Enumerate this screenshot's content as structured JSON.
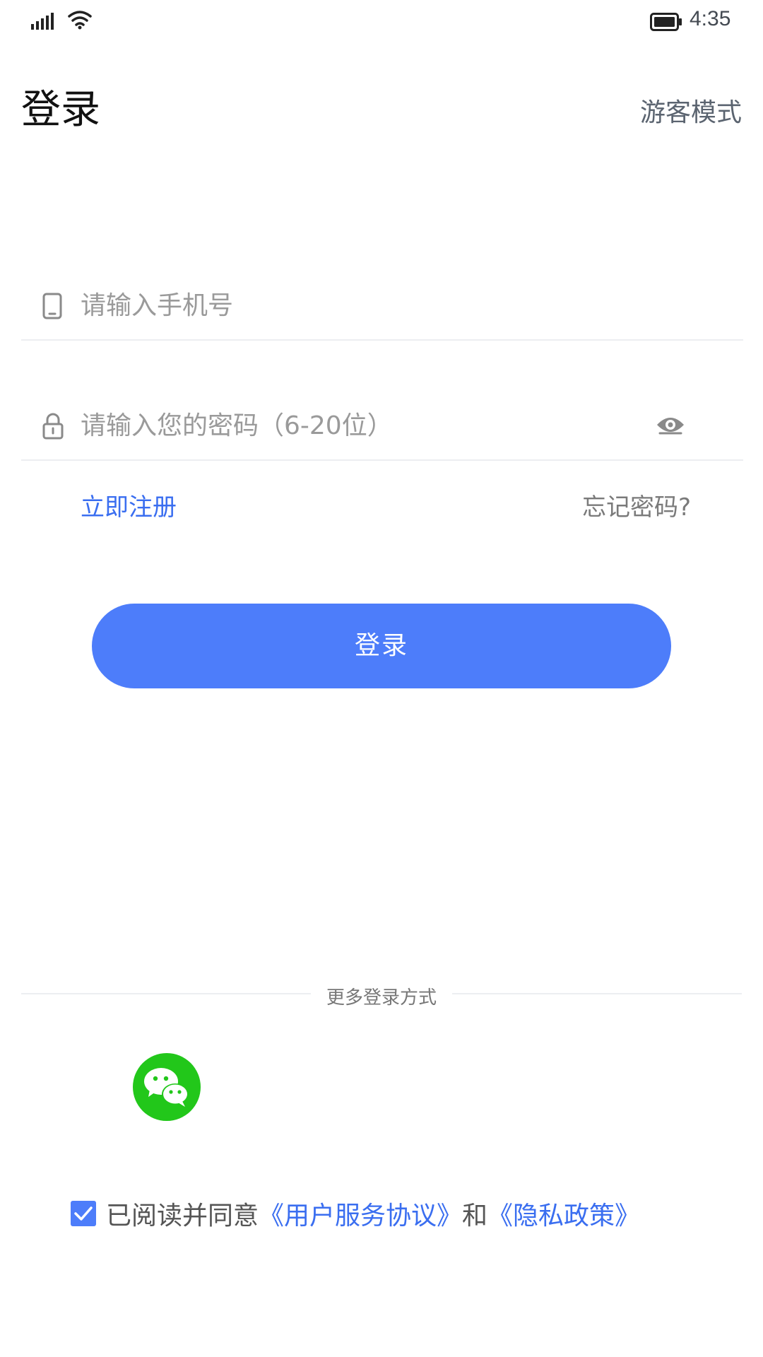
{
  "status_bar": {
    "time": "4:35",
    "signal_icon": "signal-icon",
    "wifi_icon": "wifi-icon",
    "battery_icon": "battery-icon"
  },
  "header": {
    "title": "登录",
    "guest_mode": "游客模式"
  },
  "form": {
    "phone_placeholder": "请输入手机号",
    "password_placeholder": "请输入您的密码（6-20位）",
    "register_link": "立即注册",
    "forgot_link": "忘记密码?",
    "login_button": "登录"
  },
  "more_login": {
    "label": "更多登录方式",
    "wechat_icon": "wechat-icon"
  },
  "agreement": {
    "checked": true,
    "prefix": "已阅读并同意",
    "user_agreement": "《用户服务协议》",
    "conjunction": "和",
    "privacy_policy": "《隐私政策》"
  },
  "colors": {
    "accent": "#4d7dfa",
    "link": "#3a6ef0",
    "wechat": "#22c71a",
    "placeholder": "#9a9a9a"
  }
}
